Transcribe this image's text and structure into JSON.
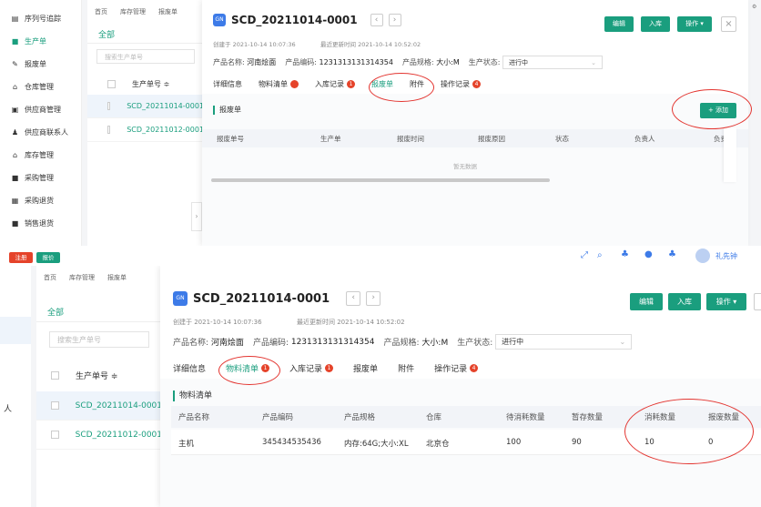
{
  "top": {
    "sidebar": [
      {
        "label": "序列号追踪",
        "icon": "barcode-icon",
        "active": false
      },
      {
        "label": "生产单",
        "icon": "production-icon",
        "active": true
      },
      {
        "label": "报废单",
        "icon": "scrap-icon",
        "active": false
      },
      {
        "label": "仓库管理",
        "icon": "warehouse-icon",
        "active": false
      },
      {
        "label": "供应商管理",
        "icon": "supplier-icon",
        "active": false
      },
      {
        "label": "供应商联系人",
        "icon": "contact-icon",
        "active": false
      },
      {
        "label": "库存管理",
        "icon": "inventory-icon",
        "active": false
      },
      {
        "label": "采购管理",
        "icon": "purchase-icon",
        "active": false
      },
      {
        "label": "采购退货",
        "icon": "return-icon",
        "active": false
      },
      {
        "label": "销售退货",
        "icon": "sales-return-icon",
        "active": false
      }
    ],
    "crumbs": [
      "首页",
      "库存管理",
      "报废单"
    ],
    "all_tab": "全部",
    "search_placeholder": "搜索生产单号",
    "list_header": "生产单号 ≑",
    "rows": [
      "SCD_20211014-0001",
      "SCD_20211012-0001"
    ],
    "detail": {
      "badge": "GN",
      "title": "SCD_20211014-0001",
      "created": "创建于 2021-10-14 10:07:36",
      "updated": "最近更新时间 2021-10-14 10:52:02",
      "product_name_label": "产品名称:",
      "product_name": "河南烩面",
      "product_code_label": "产品编码:",
      "product_code": "1231313131314354",
      "product_spec_label": "产品规格:",
      "product_spec": "大小:M",
      "status_label": "生产状态:",
      "status_value": "进行中",
      "buttons": {
        "edit": "编辑",
        "stock_in": "入库",
        "actions": "操作 ▾"
      },
      "tabs": [
        {
          "label": "详细信息",
          "badge": ""
        },
        {
          "label": "物料清单",
          "badge": ""
        },
        {
          "label": "入库记录",
          "badge": "1"
        },
        {
          "label": "报废单",
          "badge": ""
        },
        {
          "label": "附件",
          "badge": ""
        },
        {
          "label": "操作记录",
          "badge": "4"
        }
      ],
      "section_title": "报废单",
      "add_button": "+ 添加",
      "columns": [
        "报废单号",
        "生产单",
        "报废时间",
        "报废原因",
        "状态",
        "负责人",
        "负责"
      ],
      "empty": "暂无数据"
    }
  },
  "strip": {
    "left_buttons": [
      "注册",
      "报价"
    ],
    "right_user": "礼先钟"
  },
  "bottom": {
    "crumbs": [
      "首页",
      "库存管理",
      "报废单"
    ],
    "all_tab": "全部",
    "search_placeholder": "搜索生产单号",
    "list_header": "生产单号 ≑",
    "rows": [
      "SCD_20211014-0001",
      "SCD_20211012-0001"
    ],
    "side_char": "人",
    "detail": {
      "badge": "GN",
      "title": "SCD_20211014-0001",
      "created": "创建于 2021-10-14 10:07:36",
      "updated": "最近更新时间 2021-10-14 10:52:02",
      "product_name_label": "产品名称:",
      "product_name": "河南烩面",
      "product_code_label": "产品编码:",
      "product_code": "1231313131314354",
      "product_spec_label": "产品规格:",
      "product_spec": "大小:M",
      "status_label": "生产状态:",
      "status_value": "进行中",
      "buttons": {
        "edit": "编辑",
        "stock_in": "入库",
        "actions": "操作 ▾"
      },
      "tabs": [
        {
          "label": "详细信息",
          "badge": ""
        },
        {
          "label": "物料清单",
          "badge": "1"
        },
        {
          "label": "入库记录",
          "badge": "1"
        },
        {
          "label": "报废单",
          "badge": ""
        },
        {
          "label": "附件",
          "badge": ""
        },
        {
          "label": "操作记录",
          "badge": "4"
        }
      ],
      "section_title": "物料清单",
      "columns": [
        "产品名称",
        "产品编码",
        "产品规格",
        "仓库",
        "待消耗数量",
        "暂存数量",
        "消耗数量",
        "报废数量"
      ],
      "row": [
        "主机",
        "345434535436",
        "内存:64G;大小:XL",
        "北京仓",
        "100",
        "90",
        "10",
        "0"
      ]
    }
  },
  "colors": {
    "accent": "#1a9e7e",
    "badge_red": "#e5432a",
    "annotation_red": "#e3342f"
  }
}
